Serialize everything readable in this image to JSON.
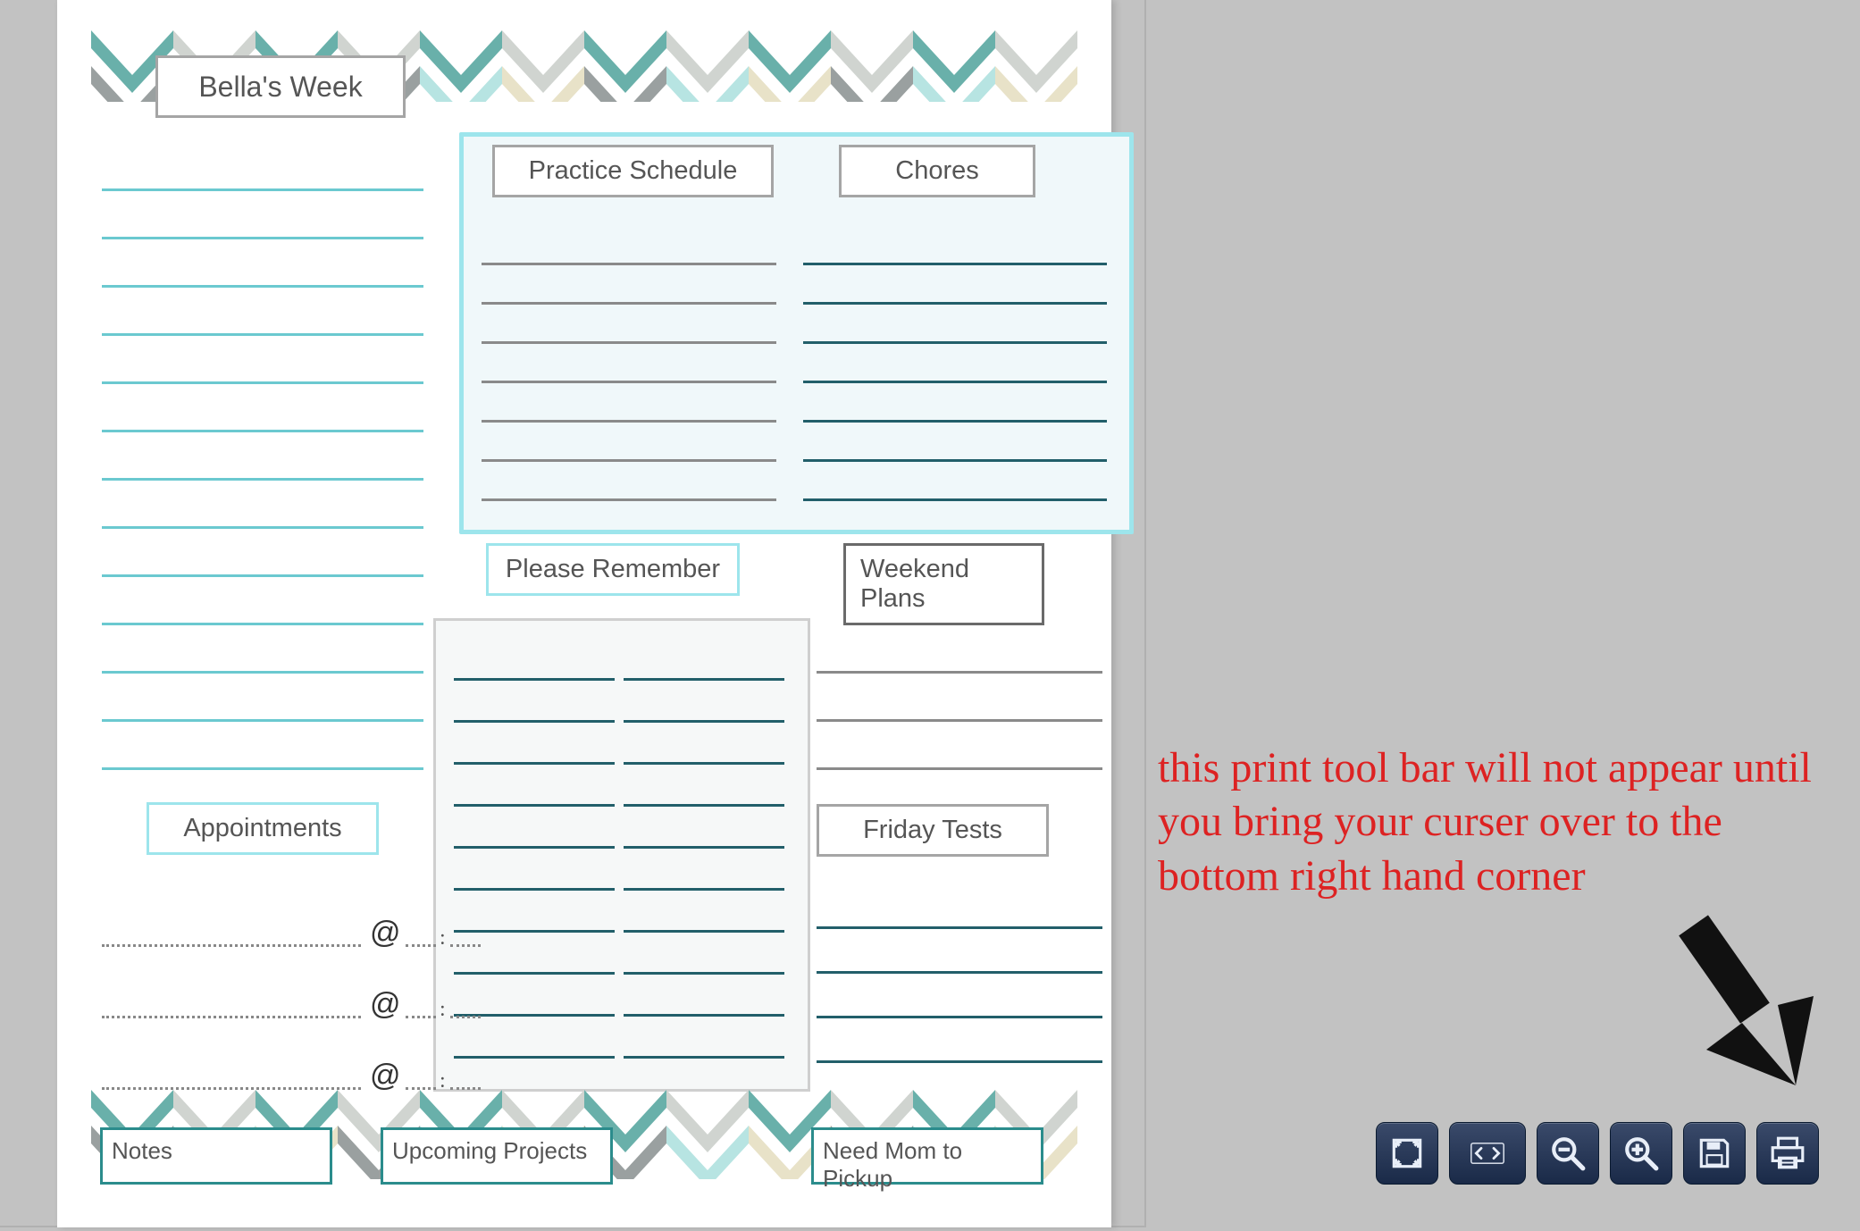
{
  "planner": {
    "title": "Bella's Week",
    "practice_label": "Practice Schedule",
    "chores_label": "Chores",
    "remember_label": "Please Remember",
    "weekend_label": "Weekend Plans",
    "appointments_label": "Appointments",
    "friday_label": "Friday Tests",
    "notes_label": "Notes",
    "upcoming_label": "Upcoming Projects",
    "pickup_label": "Need Mom to Pickup",
    "at_symbol": "@",
    "colon": ":"
  },
  "annotation": {
    "text": "this print tool bar will not appear until you bring your curser over to the bottom right hand corner"
  },
  "toolbar": {
    "fit_page": "fit-page",
    "page_nav": "page-nav",
    "zoom_out": "zoom-out",
    "zoom_in": "zoom-in",
    "save": "save",
    "print": "print"
  }
}
